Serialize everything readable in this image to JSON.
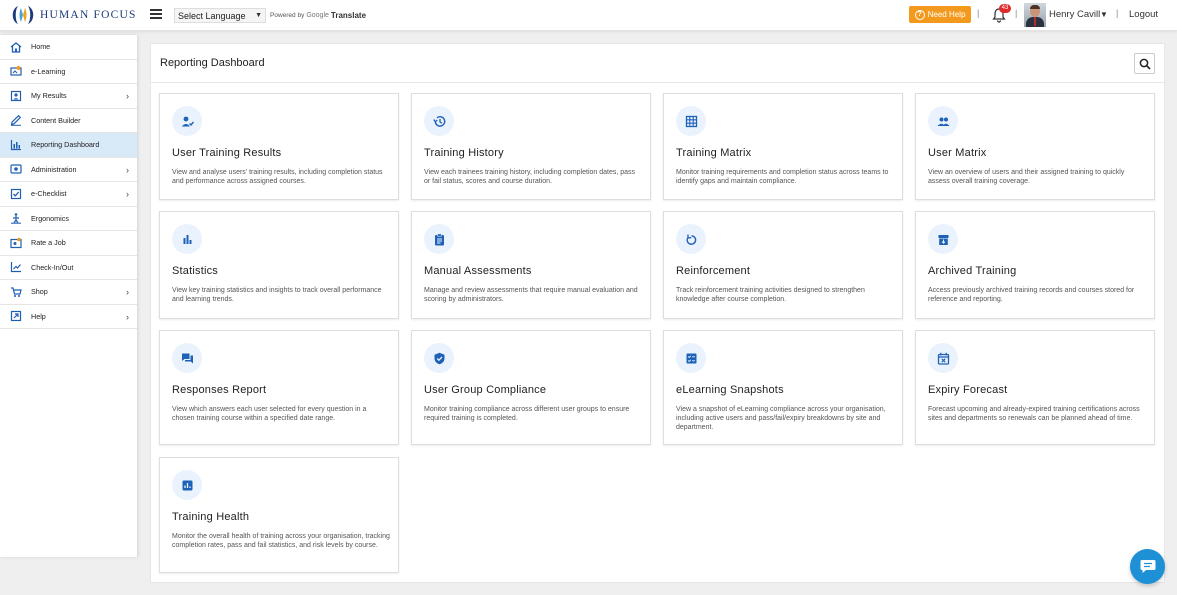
{
  "header": {
    "logo_text": "HUMAN FOCUS",
    "language_select": "Select Language",
    "powered_by": "Powered by",
    "google": "Google",
    "translate": "Translate",
    "need_help": "Need Help",
    "separator": "|",
    "notification_count": "43",
    "user_name": "Henry Cavill",
    "logout": "Logout"
  },
  "sidebar": {
    "items": [
      {
        "label": "Home",
        "icon": "home-icon",
        "chevron": false,
        "active": false
      },
      {
        "label": "e-Learning",
        "icon": "elearning-icon",
        "chevron": false,
        "active": false
      },
      {
        "label": "My Results",
        "icon": "results-icon",
        "chevron": true,
        "active": false
      },
      {
        "label": "Content Builder",
        "icon": "edit-icon",
        "chevron": false,
        "active": false
      },
      {
        "label": "Reporting Dashboard",
        "icon": "chart-icon",
        "chevron": false,
        "active": true
      },
      {
        "label": "Administration",
        "icon": "admin-icon",
        "chevron": true,
        "active": false
      },
      {
        "label": "e-Checklist",
        "icon": "checklist-icon",
        "chevron": true,
        "active": false
      },
      {
        "label": "Ergonomics",
        "icon": "ergonomics-icon",
        "chevron": false,
        "active": false
      },
      {
        "label": "Rate a Job",
        "icon": "rate-icon",
        "chevron": false,
        "active": false
      },
      {
        "label": "Check-In/Out",
        "icon": "checkin-icon",
        "chevron": false,
        "active": false
      },
      {
        "label": "Shop",
        "icon": "shop-icon",
        "chevron": true,
        "active": false
      },
      {
        "label": "Help",
        "icon": "help-icon",
        "chevron": true,
        "active": false
      }
    ]
  },
  "main": {
    "title": "Reporting Dashboard",
    "cards": [
      {
        "title": "User Training Results",
        "icon": "user-check-icon",
        "desc": "View and analyse users' training results, including completion status and performance across assigned courses."
      },
      {
        "title": "Training History",
        "icon": "history-icon",
        "desc": "View each trainees training history, including completion dates, pass or fail status, scores and course duration."
      },
      {
        "title": "Training Matrix",
        "icon": "grid-icon",
        "desc": "Monitor training requirements and completion status across teams to identify gaps and maintain compliance."
      },
      {
        "title": "User Matrix",
        "icon": "users-icon",
        "desc": "View an overview of users and their assigned training to quickly assess overall training coverage."
      },
      {
        "title": "Statistics",
        "icon": "bar-chart-icon",
        "desc": "View key training statistics and insights to track overall performance and learning trends."
      },
      {
        "title": "Manual Assessments",
        "icon": "clipboard-icon",
        "desc": "Manage and review assessments that require manual evaluation and scoring by administrators."
      },
      {
        "title": "Reinforcement",
        "icon": "refresh-icon",
        "desc": "Track reinforcement training activities designed to strengthen knowledge after course completion."
      },
      {
        "title": "Archived Training",
        "icon": "archive-icon",
        "desc": "Access previously archived training records and courses stored for reference and reporting."
      },
      {
        "title": "Responses Report",
        "icon": "forum-icon",
        "desc": "View which answers each user selected for every question in a chosen training course within a specified date range."
      },
      {
        "title": "User Group Compliance",
        "icon": "shield-check-icon",
        "desc": "Monitor training compliance across different user groups to ensure required training is completed."
      },
      {
        "title": "eLearning Snapshots",
        "icon": "checklist-box-icon",
        "desc": "View a snapshot of eLearning compliance across your organisation, including active users and pass/fail/expiry breakdowns by site and department."
      },
      {
        "title": "Expiry Forecast",
        "icon": "calendar-x-icon",
        "desc": "Forecast upcoming and already-expired training certifications across sites and departments so renewals can be planned ahead of time."
      },
      {
        "title": "Training Health",
        "icon": "analytics-icon",
        "desc": "Monitor the overall health of training across your organisation, tracking completion rates, pass and fail statistics, and risk levels by course."
      }
    ]
  },
  "colors": {
    "accent": "#1e62b7",
    "help_button": "#f39a1e",
    "active_nav": "#d8e9f8",
    "badge": "#e12b2b",
    "chat": "#1e90d6"
  }
}
